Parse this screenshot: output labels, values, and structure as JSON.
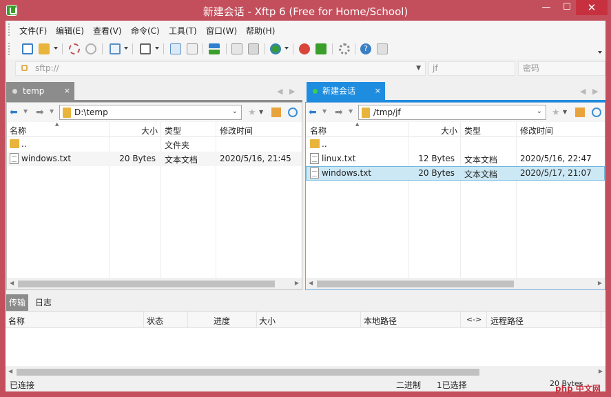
{
  "window": {
    "title": "新建会话 - Xftp 6 (Free for Home/School)",
    "minimize": "—",
    "maximize": "☐",
    "close": "✕"
  },
  "menu": [
    "文件(F)",
    "编辑(E)",
    "查看(V)",
    "命令(C)",
    "工具(T)",
    "窗口(W)",
    "帮助(H)"
  ],
  "address": {
    "host_placeholder": "sftp://",
    "user_value": "jf",
    "password_placeholder": "密码"
  },
  "tabs": {
    "left": {
      "label": "temp",
      "close": "×"
    },
    "right": {
      "label": "新建会话",
      "close": "×"
    }
  },
  "left_pane": {
    "path": "D:\\temp",
    "columns": [
      "名称",
      "大小",
      "类型",
      "修改时间"
    ],
    "rows": [
      {
        "name": "..",
        "size": "",
        "type": "文件夹",
        "modified": ""
      },
      {
        "name": "windows.txt",
        "size": "20 Bytes",
        "type": "文本文档",
        "modified": "2020/5/16, 21:45"
      }
    ]
  },
  "right_pane": {
    "path": "/tmp/jf",
    "columns": [
      "名称",
      "大小",
      "类型",
      "修改时间"
    ],
    "rows": [
      {
        "name": "..",
        "size": "",
        "type": "",
        "modified": ""
      },
      {
        "name": "linux.txt",
        "size": "12 Bytes",
        "type": "文本文档",
        "modified": "2020/5/16, 22:47"
      },
      {
        "name": "windows.txt",
        "size": "20 Bytes",
        "type": "文本文档",
        "modified": "2020/5/17, 21:07"
      }
    ]
  },
  "bottom_tabs": [
    "传输",
    "日志"
  ],
  "transfer_columns": [
    "名称",
    "状态",
    "进度",
    "大小",
    "本地路径",
    "<->",
    "远程路径"
  ],
  "status": {
    "connection": "已连接",
    "mode": "二进制",
    "selection": "1已选择",
    "size": "20 Bytes"
  },
  "watermark": "php 中文网"
}
